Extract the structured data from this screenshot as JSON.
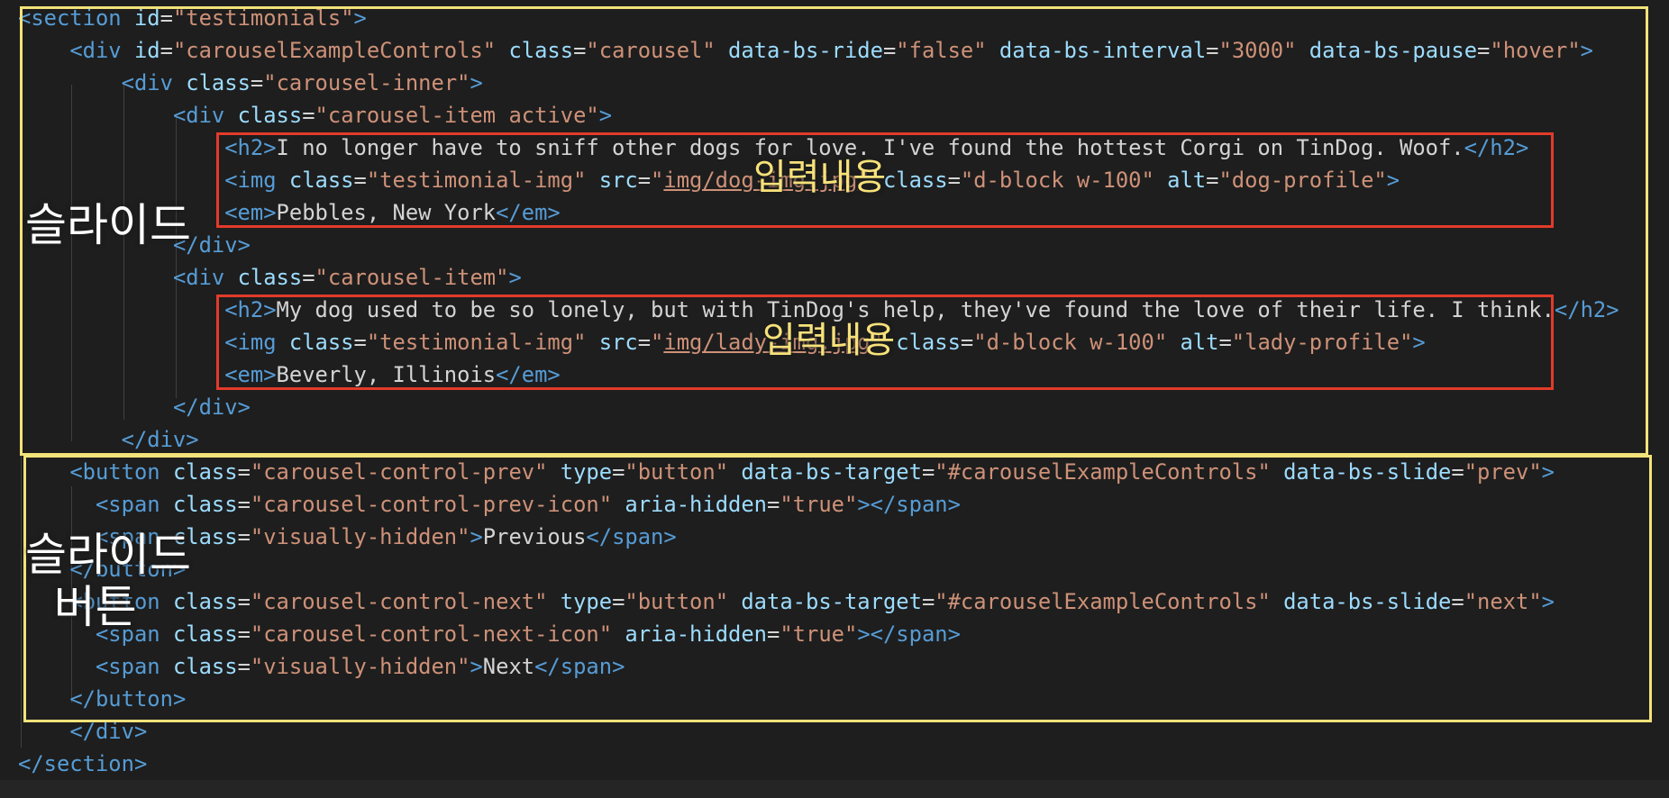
{
  "annotations": {
    "slide_label": "슬라이드",
    "slide_button_label": "슬라이드\n  버튼",
    "input_content_label": "입력내용"
  },
  "colors": {
    "tag": "#569cd6",
    "attribute": "#9cdcfe",
    "string": "#ce9178",
    "text": "#d4d4d4",
    "background": "#1e1e1e",
    "yellow_box": "#f2e27a",
    "red_box": "#e23b2a"
  },
  "code_lines": [
    "<section id=\"testimonials\">",
    "    <div id=\"carouselExampleControls\" class=\"carousel\" data-bs-ride=\"false\" data-bs-interval=\"3000\" data-bs-pause=\"hover\">",
    "        <div class=\"carousel-inner\">",
    "            <div class=\"carousel-item active\">",
    "                <h2>I no longer have to sniff other dogs for love. I've found the hottest Corgi on TinDog. Woof.</h2>",
    "                <img class=\"testimonial-img\" src=\"img/dog-img.jpg\" class=\"d-block w-100\" alt=\"dog-profile\">",
    "                <em>Pebbles, New York</em>",
    "            </div>",
    "            <div class=\"carousel-item\">",
    "                <h2>My dog used to be so lonely, but with TinDog's help, they've found the love of their life. I think.</h2>",
    "                <img class=\"testimonial-img\" src=\"img/lady-img.jpg\" class=\"d-block w-100\" alt=\"lady-profile\">",
    "                <em>Beverly, Illinois</em>",
    "            </div>",
    "        </div>",
    "    <button class=\"carousel-control-prev\" type=\"button\" data-bs-target=\"#carouselExampleControls\" data-bs-slide=\"prev\">",
    "      <span class=\"carousel-control-prev-icon\" aria-hidden=\"true\"></span>",
    "      <span class=\"visually-hidden\">Previous</span>",
    "    </button>",
    "    <button class=\"carousel-control-next\" type=\"button\" data-bs-target=\"#carouselExampleControls\" data-bs-slide=\"next\">",
    "      <span class=\"carousel-control-next-icon\" aria-hidden=\"true\"></span>",
    "      <span class=\"visually-hidden\">Next</span>",
    "    </button>",
    "    </div>",
    "</section>"
  ]
}
